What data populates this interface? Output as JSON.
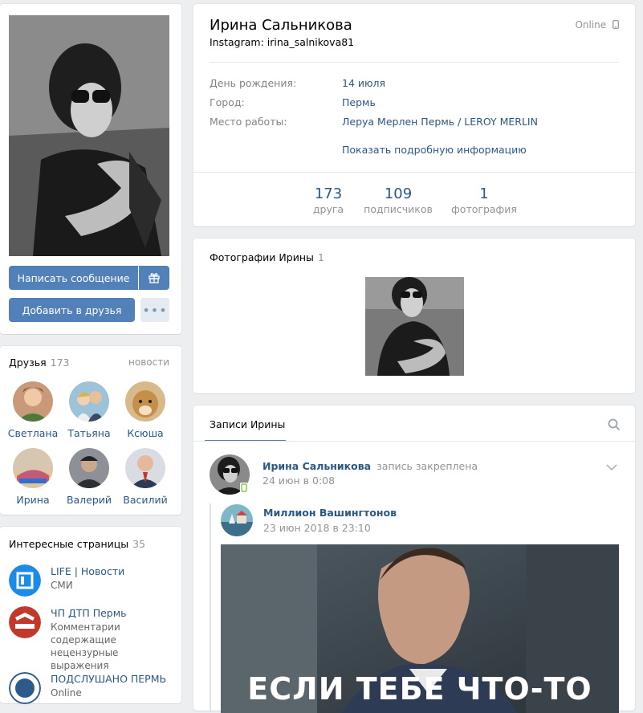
{
  "profile": {
    "name": "Ирина Сальникова",
    "status": "Instagram: irina_salnikova81",
    "online": "Online",
    "info": [
      {
        "label": "День рождения:",
        "value": "14 июля"
      },
      {
        "label": "Город:",
        "value": "Пермь"
      },
      {
        "label": "Место работы:",
        "value": "Леруа Мерлен Пермь / LEROY MERLIN"
      }
    ],
    "show_more": "Показать подробную информацию",
    "counters": [
      {
        "n": "173",
        "label": "друга"
      },
      {
        "n": "109",
        "label": "подписчиков"
      },
      {
        "n": "1",
        "label": "фотография"
      }
    ]
  },
  "actions": {
    "message": "Написать сообщение",
    "add_friend": "Добавить в друзья",
    "more": "•••"
  },
  "friends": {
    "title": "Друзья",
    "count": "173",
    "news": "новости",
    "list": [
      {
        "name": "Светлана"
      },
      {
        "name": "Татьяна"
      },
      {
        "name": "Ксюша"
      },
      {
        "name": "Ирина"
      },
      {
        "name": "Валерий"
      },
      {
        "name": "Василий"
      }
    ]
  },
  "pages": {
    "title": "Интересные страницы",
    "count": "35",
    "list": [
      {
        "title": "LIFE | Новости",
        "desc": "СМИ"
      },
      {
        "title": "ЧП ДТП Пермь",
        "desc": "Комментарии содержащие нецензурные выражения"
      },
      {
        "title": "ПОДСЛУШАНО ПЕРМЬ",
        "desc": "Online"
      }
    ]
  },
  "photos": {
    "title": "Фотографии Ирины",
    "count": "1"
  },
  "wall": {
    "tab": "Записи Ирины",
    "post": {
      "author": "Ирина Сальникова",
      "action": "запись закреплена",
      "date": "24 июн в 0:08",
      "repost_author": "Миллион Вашингтонов",
      "repost_date": "23 июн 2018 в 23:10",
      "image_text": "ЕСЛИ ТЕБЕ ЧТО-ТО"
    }
  },
  "colors": {
    "accent": "#5181b8",
    "link": "#2a5885",
    "bg": "#edeef0",
    "online_icon": "#8bc34a"
  }
}
